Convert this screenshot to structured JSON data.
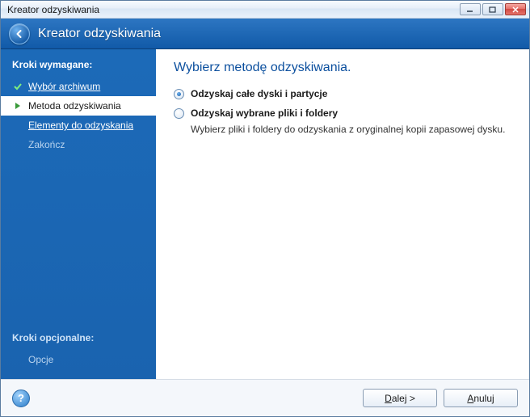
{
  "window": {
    "title": "Kreator odzyskiwania"
  },
  "header": {
    "title": "Kreator odzyskiwania"
  },
  "sidebar": {
    "required_title": "Kroki wymagane:",
    "steps": [
      {
        "label": "Wybór archiwum"
      },
      {
        "label": "Metoda odzyskiwania"
      },
      {
        "label": "Elementy do odzyskania"
      },
      {
        "label": "Zakończ"
      }
    ],
    "optional_title": "Kroki opcjonalne:",
    "optional_steps": [
      {
        "label": "Opcje"
      }
    ]
  },
  "main": {
    "heading": "Wybierz metodę odzyskiwania.",
    "options": [
      {
        "label": "Odzyskaj całe dyski i partycje",
        "checked": true
      },
      {
        "label": "Odzyskaj wybrane pliki i foldery",
        "checked": false,
        "desc": "Wybierz pliki i foldery do odzyskania z oryginalnej kopii zapasowej dysku."
      }
    ]
  },
  "footer": {
    "next_prefix": "D",
    "next_suffix": "alej >",
    "cancel_prefix": "A",
    "cancel_suffix": "nuluj"
  }
}
